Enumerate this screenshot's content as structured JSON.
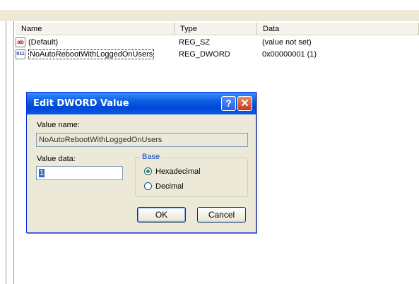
{
  "listview": {
    "columns": [
      "Name",
      "Type",
      "Data"
    ],
    "rows": [
      {
        "icon": "string-value-icon",
        "icon_text": "ab",
        "name": "(Default)",
        "type": "REG_SZ",
        "data": "(value not set)"
      },
      {
        "icon": "dword-value-icon",
        "icon_text": "011",
        "name": "NoAutoRebootWithLoggedOnUsers",
        "type": "REG_DWORD",
        "data": "0x00000001 (1)"
      }
    ]
  },
  "dialog": {
    "title": "Edit DWORD Value",
    "value_name_label": "Value name:",
    "value_name": "NoAutoRebootWithLoggedOnUsers",
    "value_data_label": "Value data:",
    "value_data": "1",
    "base_label": "Base",
    "base_options": [
      "Hexadecimal",
      "Decimal"
    ],
    "base_selected": "Hexadecimal",
    "ok_label": "OK",
    "cancel_label": "Cancel",
    "help_glyph": "?",
    "close_glyph": "✕"
  }
}
